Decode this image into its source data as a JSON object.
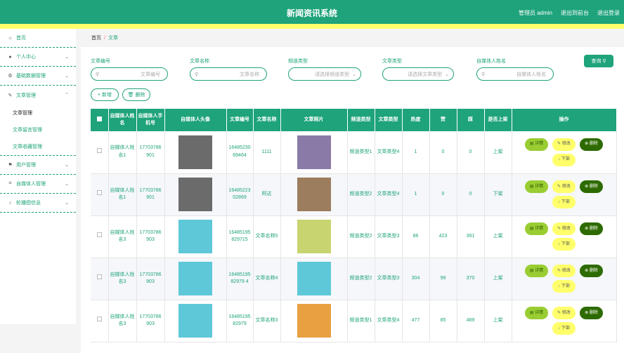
{
  "header": {
    "title": "新闻资讯系统",
    "admin_label": "管理员 admin",
    "back_label": "退出到前台",
    "logout_label": "退出登录"
  },
  "sidebar": {
    "items": [
      {
        "label": "首页",
        "icon": "home-icon"
      },
      {
        "label": "个人中心",
        "icon": "user-icon"
      },
      {
        "label": "基础数据管理",
        "icon": "gear-icon"
      },
      {
        "label": "文章管理",
        "icon": "document-icon"
      },
      {
        "label": "用户管理",
        "icon": "flag-icon"
      },
      {
        "label": "自媒体人管理",
        "icon": "crop-icon"
      },
      {
        "label": "轮播图信息",
        "icon": "circle-icon"
      }
    ],
    "sub_items": [
      "文章管理",
      "文章留言管理",
      "文章收藏管理"
    ]
  },
  "breadcrumb": {
    "home": "首页",
    "separator": "/",
    "current": "文章"
  },
  "search": {
    "fields": [
      {
        "label": "文章编号",
        "placeholder": "文章编号"
      },
      {
        "label": "文章名称",
        "placeholder": "文章名称"
      },
      {
        "label": "频道类型",
        "placeholder": "请选择频道类型"
      },
      {
        "label": "文章类型",
        "placeholder": "请选择文章类型"
      },
      {
        "label": "自媒体人姓名",
        "placeholder": "自媒体人姓名"
      }
    ],
    "button": "查询"
  },
  "actions": {
    "add": "+ 新增",
    "delete": "删除"
  },
  "table": {
    "headers": [
      "自媒体人姓名",
      "自媒体人手机号",
      "自媒体人头像",
      "文章编号",
      "文章名称",
      "文章照片",
      "频道类型",
      "文章类型",
      "热度",
      "赞",
      "踩",
      "是否上架",
      "操作"
    ],
    "ops": {
      "detail": "详情",
      "edit": "修改",
      "del": "删除",
      "shelf": "下架"
    },
    "rows": [
      {
        "name": "自媒体人姓名1",
        "phone": "17703786901",
        "code": "1648523069464",
        "title": "1111",
        "channel": "频道类型1",
        "type": "文章类型4",
        "heat": "1",
        "like": "0",
        "dislike": "0",
        "status": "上架",
        "avatar": "#6b6b6b",
        "photo": "#8a7aa8"
      },
      {
        "name": "自媒体人姓名1",
        "phone": "17703786901",
        "code": "1648522302869",
        "title": "阿达",
        "channel": "频道类型2",
        "type": "文章类型4",
        "heat": "1",
        "like": "0",
        "dislike": "0",
        "status": "下架",
        "avatar": "#6b6b6b",
        "photo": "#9c7d5e"
      },
      {
        "name": "自媒体人姓名3",
        "phone": "17703786903",
        "code": "16485195829715",
        "title": "文章名称5",
        "channel": "频道类型2",
        "type": "文章类型3",
        "heat": "86",
        "like": "423",
        "dislike": "391",
        "status": "上架",
        "avatar": "#5fc8d8",
        "photo": "#c8d470"
      },
      {
        "name": "自媒体人姓名3",
        "phone": "17703786903",
        "code": "1648519582979 4",
        "title": "文章名称4",
        "channel": "频道类型2",
        "type": "文章类型3",
        "heat": "304",
        "like": "99",
        "dislike": "370",
        "status": "上架",
        "avatar": "#5fc8d8",
        "photo": "#5fc8d8"
      },
      {
        "name": "自媒体人姓名3",
        "phone": "17703786903",
        "code": "1648519582979",
        "title": "文章名称3",
        "channel": "频道类型1",
        "type": "文章类型4",
        "heat": "477",
        "like": "85",
        "dislike": "489",
        "status": "上架",
        "avatar": "#5fc8d8",
        "photo": "#e8a040"
      }
    ]
  }
}
